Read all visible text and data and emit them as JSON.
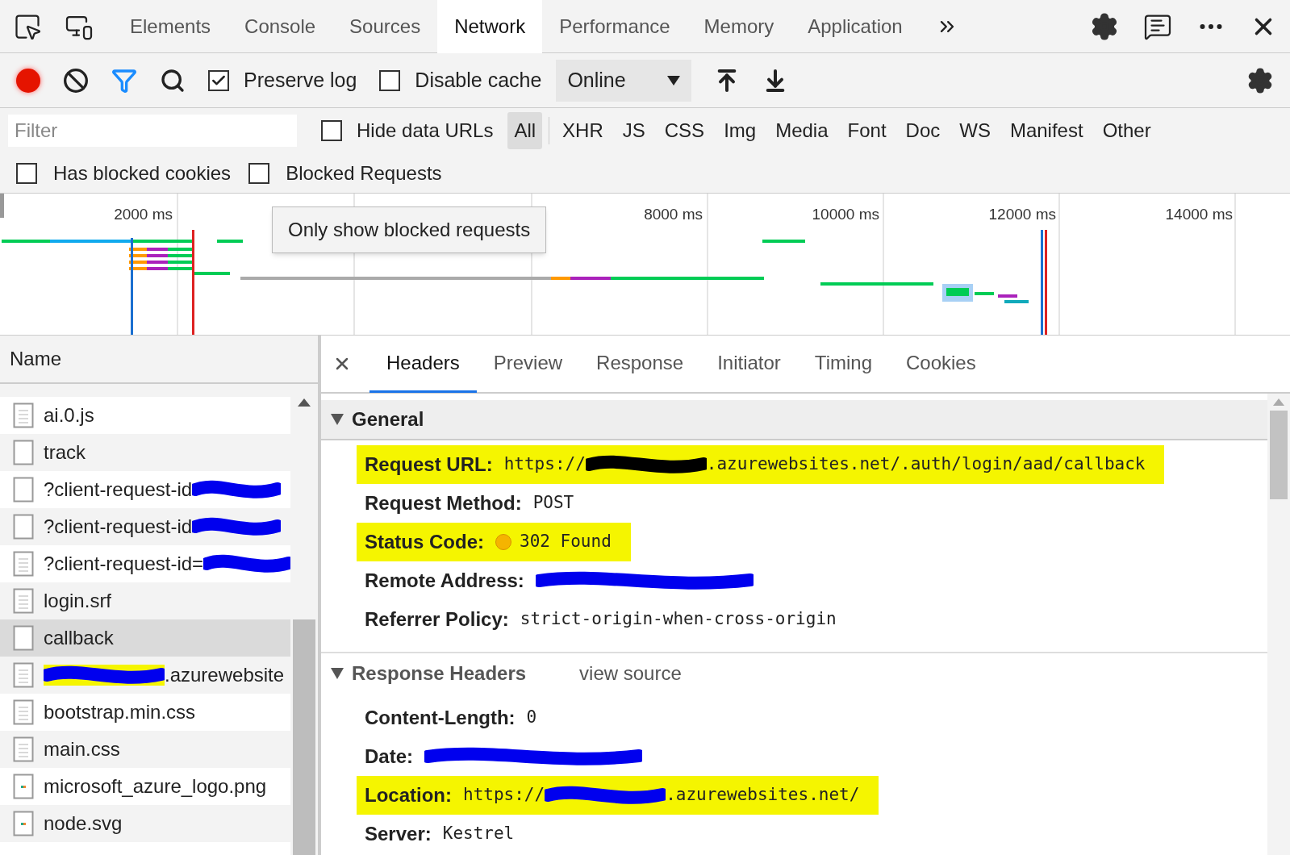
{
  "main_tabs": [
    {
      "label": "Elements",
      "selected": false
    },
    {
      "label": "Console",
      "selected": false
    },
    {
      "label": "Sources",
      "selected": false
    },
    {
      "label": "Network",
      "selected": true
    },
    {
      "label": "Performance",
      "selected": false
    },
    {
      "label": "Memory",
      "selected": false
    },
    {
      "label": "Application",
      "selected": false
    }
  ],
  "toolbar": {
    "recording": true,
    "filter_active": true,
    "preserve_log": {
      "label": "Preserve log",
      "checked": true
    },
    "disable_cache": {
      "label": "Disable cache",
      "checked": false
    },
    "throttling": "Online"
  },
  "filter": {
    "placeholder": "Filter",
    "hide_data_urls": {
      "label": "Hide data URLs",
      "checked": false
    },
    "types": [
      {
        "label": "All",
        "selected": true
      },
      {
        "label": "XHR",
        "selected": false
      },
      {
        "label": "JS",
        "selected": false
      },
      {
        "label": "CSS",
        "selected": false
      },
      {
        "label": "Img",
        "selected": false
      },
      {
        "label": "Media",
        "selected": false
      },
      {
        "label": "Font",
        "selected": false
      },
      {
        "label": "Doc",
        "selected": false
      },
      {
        "label": "WS",
        "selected": false
      },
      {
        "label": "Manifest",
        "selected": false
      },
      {
        "label": "Other",
        "selected": false
      }
    ],
    "has_blocked_cookies": {
      "label": "Has blocked cookies",
      "checked": false
    },
    "blocked_requests": {
      "label": "Blocked Requests",
      "checked": false
    }
  },
  "overview": {
    "ticks": [
      "2000 ms",
      "8000 ms",
      "10000 ms",
      "12000 ms",
      "14000 ms"
    ],
    "tooltip": "Only show blocked requests"
  },
  "requests": {
    "column": "Name",
    "rows": [
      {
        "name": "ai.0.js",
        "kind": "doc",
        "selected": false
      },
      {
        "name": "track",
        "kind": "blank",
        "selected": false
      },
      {
        "name": "?client-request-id",
        "kind": "blank",
        "selected": false,
        "redacted_after": true
      },
      {
        "name": "?client-request-id",
        "kind": "blank",
        "selected": false,
        "redacted_after": true
      },
      {
        "name": "?client-request-id=",
        "kind": "doc",
        "selected": false,
        "redacted_after": true
      },
      {
        "name": "login.srf",
        "kind": "doc",
        "selected": false
      },
      {
        "name": "callback",
        "kind": "blank",
        "selected": true
      },
      {
        "name": ".azurewebsite",
        "kind": "doc",
        "selected": false,
        "redacted_before": true
      },
      {
        "name": "bootstrap.min.css",
        "kind": "doc",
        "selected": false
      },
      {
        "name": "main.css",
        "kind": "doc",
        "selected": false
      },
      {
        "name": "microsoft_azure_logo.png",
        "kind": "image",
        "selected": false
      },
      {
        "name": "node.svg",
        "kind": "image",
        "selected": false
      }
    ]
  },
  "detail_tabs": [
    {
      "label": "Headers",
      "selected": true
    },
    {
      "label": "Preview",
      "selected": false
    },
    {
      "label": "Response",
      "selected": false
    },
    {
      "label": "Initiator",
      "selected": false
    },
    {
      "label": "Timing",
      "selected": false
    },
    {
      "label": "Cookies",
      "selected": false
    }
  ],
  "sections": [
    {
      "title": "General",
      "expanded": true,
      "rows": [
        {
          "name": "Request URL:",
          "kind": "text",
          "value_before": "https://",
          "redacted": true,
          "value_after": ".azurewebsites.net/.auth/login/aad/callback",
          "highlighted": true
        },
        {
          "name": "Request Method:",
          "kind": "text",
          "value_before": "POST",
          "highlighted": false
        },
        {
          "name": "Status Code:",
          "kind": "status",
          "value_before": "302 Found",
          "highlighted": true
        },
        {
          "name": "Remote Address:",
          "kind": "text",
          "redacted": true,
          "highlighted": false
        },
        {
          "name": "Referrer Policy:",
          "kind": "text",
          "value_before": "strict-origin-when-cross-origin",
          "highlighted": false
        }
      ]
    },
    {
      "title": "Response Headers",
      "expanded": true,
      "link": "view source",
      "rows": [
        {
          "name": "Content-Length:",
          "kind": "text",
          "value_before": "0",
          "highlighted": false
        },
        {
          "name": "Date:",
          "kind": "text",
          "redacted": true,
          "highlighted": false
        },
        {
          "name": "Location:",
          "kind": "text",
          "value_before": "https://",
          "redacted": true,
          "value_after": ".azurewebsites.net/",
          "highlighted": true
        },
        {
          "name": "Server:",
          "kind": "text",
          "value_before": "Kestrel",
          "highlighted": false
        }
      ]
    }
  ]
}
